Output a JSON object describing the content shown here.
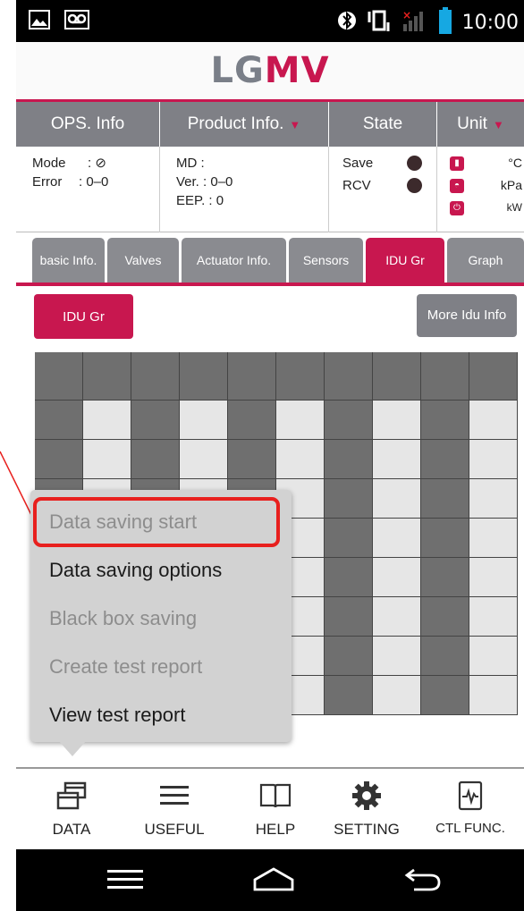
{
  "status_bar": {
    "time": "10:00",
    "left_icons": [
      "image-icon",
      "voicemail-icon"
    ],
    "right_icons": [
      "bluetooth-icon",
      "vibrate-icon",
      "no-signal-icon",
      "battery-icon"
    ]
  },
  "app": {
    "logo_part1": "LG",
    "logo_part2": "MV",
    "brand_color": "#c8174f"
  },
  "info_panel": {
    "headers": {
      "ops": "OPS. Info",
      "product": "Product Info.",
      "state": "State",
      "unit": "Unit"
    },
    "ops": {
      "mode_label": "Mode",
      "mode_value": ": ⊘",
      "error_label": "Error",
      "error_value": ": 0–0"
    },
    "product": {
      "md": "MD :",
      "ver": "Ver. : 0–0",
      "eep": "EEP. : 0"
    },
    "state": {
      "save_label": "Save",
      "rcv_label": "RCV"
    },
    "unit": {
      "temp": "°C",
      "pressure": "kPa",
      "power": "kW"
    }
  },
  "tabs": [
    {
      "label": "basic Info."
    },
    {
      "label": "Valves"
    },
    {
      "label": "Actuator Info."
    },
    {
      "label": "Sensors"
    },
    {
      "label": "IDU Gr",
      "active": true
    },
    {
      "label": "Graph"
    }
  ],
  "buttons": {
    "idu_gr": "IDU Gr",
    "more_idu_info": "More Idu Info"
  },
  "popup_menu": {
    "items": [
      {
        "label": "Data saving start",
        "enabled": false,
        "highlighted": true
      },
      {
        "label": "Data saving options",
        "enabled": true
      },
      {
        "label": "Black box saving",
        "enabled": false
      },
      {
        "label": "Create test report",
        "enabled": false
      },
      {
        "label": "View test report",
        "enabled": true
      }
    ]
  },
  "bottom_nav": [
    {
      "label": "DATA",
      "icon": "windows-icon"
    },
    {
      "label": "USEFUL",
      "icon": "menu-lines-icon"
    },
    {
      "label": "HELP",
      "icon": "book-icon"
    },
    {
      "label": "SETTING",
      "icon": "gear-icon"
    },
    {
      "label": "CTL FUNC.",
      "icon": "pulse-monitor-icon"
    }
  ],
  "colors": {
    "accent": "#c8174f",
    "header_gray": "#7f8086",
    "tab_gray": "#8a8b90",
    "grid_dark": "#6f6f6f",
    "grid_light": "#e6e6e6",
    "highlight_red": "#e8201e"
  }
}
